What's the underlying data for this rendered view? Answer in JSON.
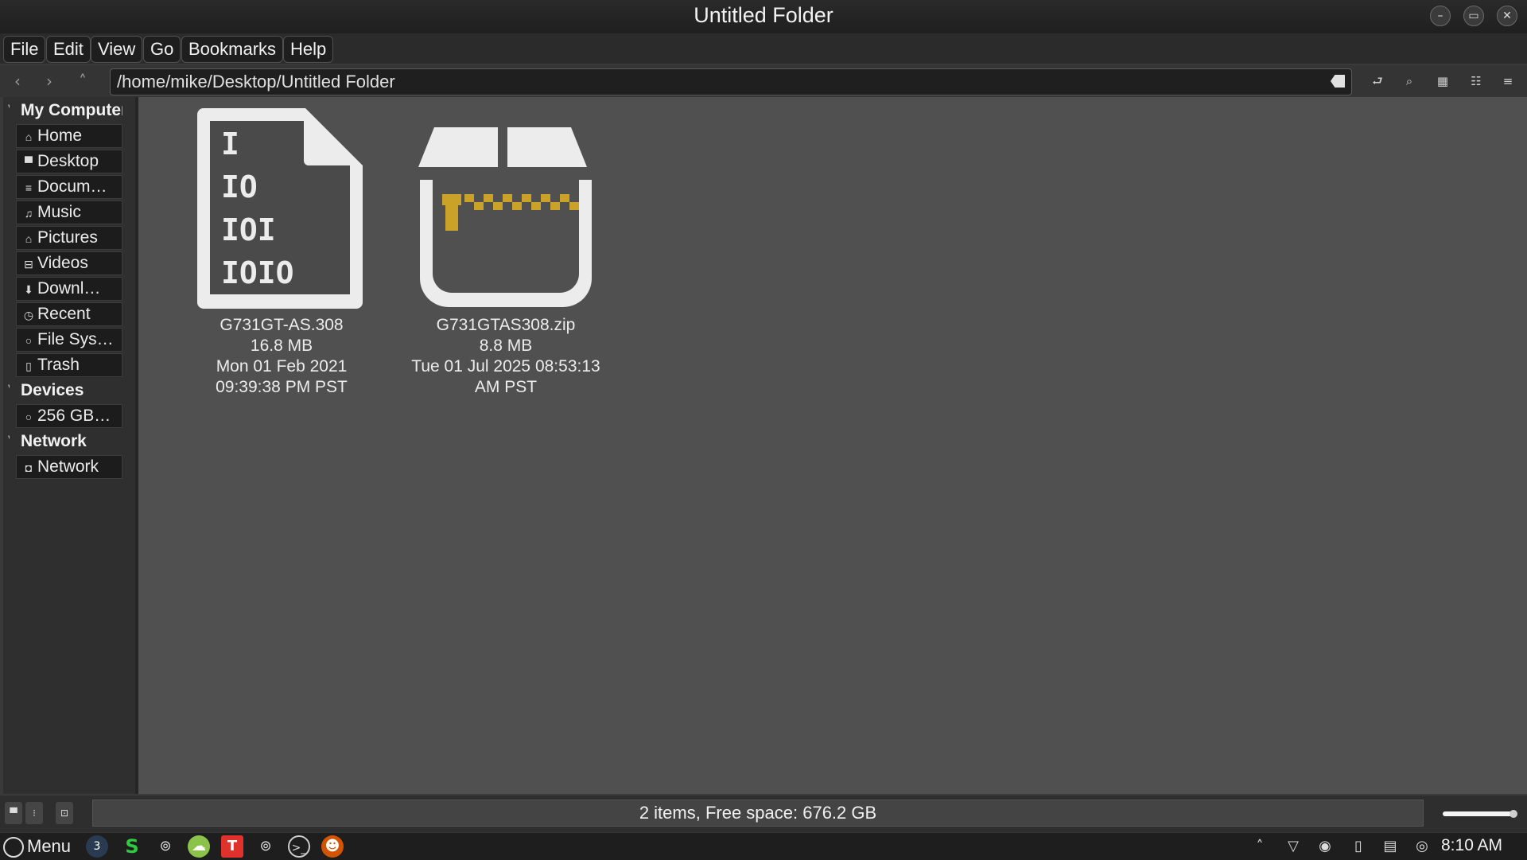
{
  "window": {
    "title": "Untitled Folder",
    "controls": [
      "minimize-icon",
      "maximize-icon",
      "close-icon"
    ]
  },
  "menubar": {
    "items": [
      {
        "label": "File"
      },
      {
        "label": "Edit"
      },
      {
        "label": "View"
      },
      {
        "label": "Go"
      },
      {
        "label": "Bookmarks"
      },
      {
        "label": "Help"
      }
    ]
  },
  "toolbar": {
    "path": "/home/mike/Desktop/Untitled Folder"
  },
  "sidebar": {
    "sections": [
      {
        "header": "My Computer",
        "items": [
          {
            "label": "Home",
            "icon": "home-icon"
          },
          {
            "label": "Desktop",
            "icon": "desktop-icon"
          },
          {
            "label": "Docum…",
            "icon": "documents-icon"
          },
          {
            "label": "Music",
            "icon": "music-icon"
          },
          {
            "label": "Pictures",
            "icon": "pictures-icon"
          },
          {
            "label": "Videos",
            "icon": "videos-icon"
          },
          {
            "label": "Downl…",
            "icon": "downloads-icon"
          },
          {
            "label": "Recent",
            "icon": "recent-icon"
          },
          {
            "label": "File Sys…",
            "icon": "filesystem-icon"
          },
          {
            "label": "Trash",
            "icon": "trash-icon"
          }
        ]
      },
      {
        "header": "Devices",
        "items": [
          {
            "label": "256 GB…",
            "icon": "drive-icon"
          }
        ]
      },
      {
        "header": "Network",
        "items": [
          {
            "label": "Network",
            "icon": "network-icon"
          }
        ]
      }
    ]
  },
  "files": [
    {
      "name": "G731GT-AS.308",
      "size": "16.8 MB",
      "date_line1": "Mon 01 Feb 2021",
      "date_line2": "09:39:38 PM PST",
      "icon": "binary-file-icon"
    },
    {
      "name": "G731GTAS308.zip",
      "size": "8.8 MB",
      "date_line1": "Tue 01 Jul 2025 08:53:13",
      "date_line2": "AM PST",
      "icon": "archive-icon"
    }
  ],
  "statusbar": {
    "text": "2 items, Free space: 676.2 GB"
  },
  "taskbar": {
    "menu_label": "Menu",
    "badge": "3",
    "clock": "8:10 AM"
  },
  "colors": {
    "zip_accent": "#c9a227",
    "content_bg": "#505050"
  }
}
